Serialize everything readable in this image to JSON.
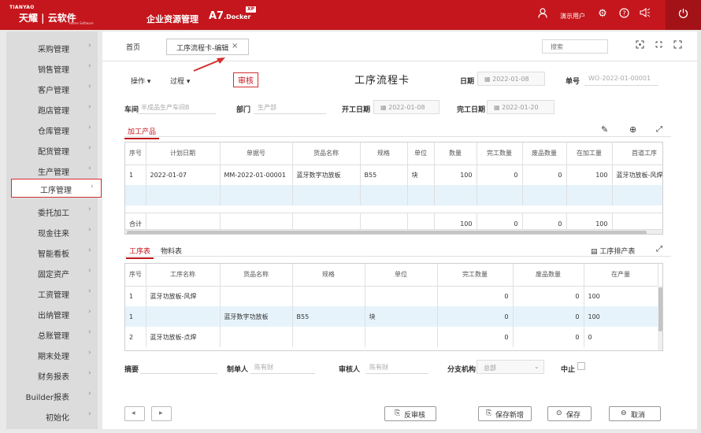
{
  "topbar": {
    "brand_small": "TIANYAO",
    "brand_main": "天耀 | 云软件",
    "brand_sub": "Home Software",
    "system_name": "企业资源管理",
    "product_name": "A7",
    "product_suffix": ".Docker",
    "product_badge": "XP",
    "user_name": "演示用户",
    "accent_color": "#c4161c"
  },
  "sidebar": {
    "items": [
      {
        "label": "采购管理"
      },
      {
        "label": "销售管理"
      },
      {
        "label": "客户管理"
      },
      {
        "label": "跑店管理"
      },
      {
        "label": "仓库管理"
      },
      {
        "label": "配货管理"
      },
      {
        "label": "生产管理"
      },
      {
        "label": "工序管理",
        "active": true
      },
      {
        "label": "委托加工"
      },
      {
        "label": "现金往来"
      },
      {
        "label": "智能看板"
      },
      {
        "label": "固定资产"
      },
      {
        "label": "工资管理"
      },
      {
        "label": "出纳管理"
      },
      {
        "label": "总账管理"
      },
      {
        "label": "期末处理"
      },
      {
        "label": "财务报表"
      },
      {
        "label": "Builder报表"
      },
      {
        "label": "初始化"
      }
    ]
  },
  "tabs": {
    "home": "首页",
    "active": "工序流程卡-编辑",
    "close": "×",
    "search_placeholder": "搜索"
  },
  "form": {
    "title": "工序流程卡",
    "menu_operation": "操作",
    "menu_process": "过程",
    "audit_label": "审核",
    "date_label": "日期",
    "date_value": "2022-01-08",
    "no_label": "单号",
    "no_value": "WO-2022-01-00001",
    "workshop_label": "车间",
    "workshop_placeholder": "半成品生产车间B",
    "dept_label": "部门",
    "dept_placeholder": "生产部",
    "start_label": "开工日期",
    "start_value": "2022-01-08",
    "finish_label": "完工日期",
    "finish_value": "2022-01-20"
  },
  "products": {
    "tab": "加工产品",
    "columns": [
      "序号",
      "计划日期",
      "单据号",
      "货品名称",
      "规格",
      "单位",
      "数量",
      "完工数量",
      "废品数量",
      "在加工量",
      "首道工序"
    ],
    "rows": [
      [
        "1",
        "2022-01-07",
        "MM-2022-01-00001",
        "蓝牙数字功放板",
        "B55",
        "块",
        "100",
        "0",
        "0",
        "100",
        "蓝牙功放板-风焊"
      ]
    ],
    "total_label": "合计",
    "totals": [
      "",
      "",
      "",
      "",
      "",
      "",
      "100",
      "0",
      "0",
      "100",
      ""
    ]
  },
  "process": {
    "tab_process": "工序表",
    "tab_material": "物料表",
    "schedule_label": "工序排产表",
    "columns": [
      "序号",
      "工序名称",
      "货品名称",
      "规格",
      "单位",
      "完工数量",
      "废品数量",
      "在产量"
    ],
    "rows": [
      [
        "1",
        "蓝牙功放板-风焊",
        "",
        "",
        "",
        "0",
        "0",
        "100"
      ],
      [
        "1",
        "",
        "蓝牙数字功放板",
        "B55",
        "块",
        "0",
        "0",
        "100"
      ],
      [
        "2",
        "蓝牙功放板-点焊",
        "",
        "",
        "",
        "0",
        "0",
        "0"
      ]
    ]
  },
  "footer": {
    "summary_label": "摘要",
    "maker_label": "制单人",
    "maker_value": "陈有财",
    "auditor_label": "审核人",
    "auditor_value": "陈有财",
    "branch_label": "分支机构",
    "branch_value": "总部",
    "stop_label": "中止"
  },
  "actions": {
    "unaudit": "反审核",
    "save_new": "保存新增",
    "save": "保存",
    "cancel": "取消"
  }
}
